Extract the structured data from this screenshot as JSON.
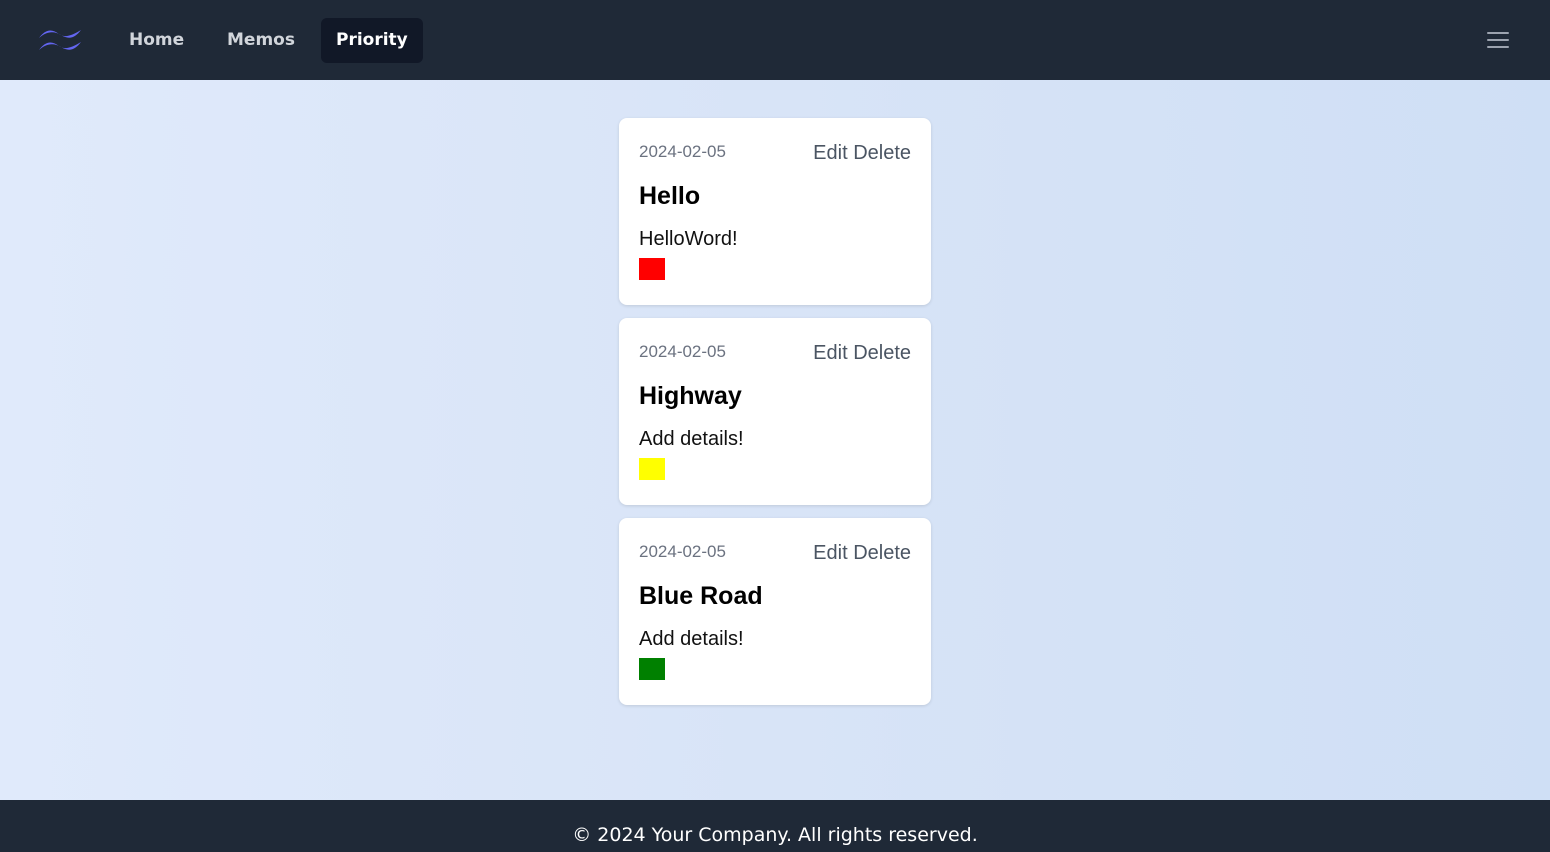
{
  "nav": {
    "logo_icon": "tailwind-wave-logo",
    "items": [
      {
        "label": "Home"
      },
      {
        "label": "Memos"
      },
      {
        "label": "Priority"
      }
    ],
    "active_item": "Priority",
    "menu_icon": "hamburger-menu-icon"
  },
  "memos": [
    {
      "date": "2024-02-05",
      "edit_label": "Edit",
      "delete_label": "Delete",
      "title": "Hello",
      "details": "HelloWord!",
      "priority_color": "#ff0000"
    },
    {
      "date": "2024-02-05",
      "edit_label": "Edit",
      "delete_label": "Delete",
      "title": "Highway",
      "details": "Add details!",
      "priority_color": "#ffff00"
    },
    {
      "date": "2024-02-05",
      "edit_label": "Edit",
      "delete_label": "Delete",
      "title": "Blue Road",
      "details": "Add details!",
      "priority_color": "#008000"
    }
  ],
  "footer": {
    "text": "© 2024 Your Company. All rights reserved."
  },
  "colors": {
    "nav_bg": "#1f2937",
    "active_tab_bg": "#111827",
    "logo": "#6366f1"
  }
}
